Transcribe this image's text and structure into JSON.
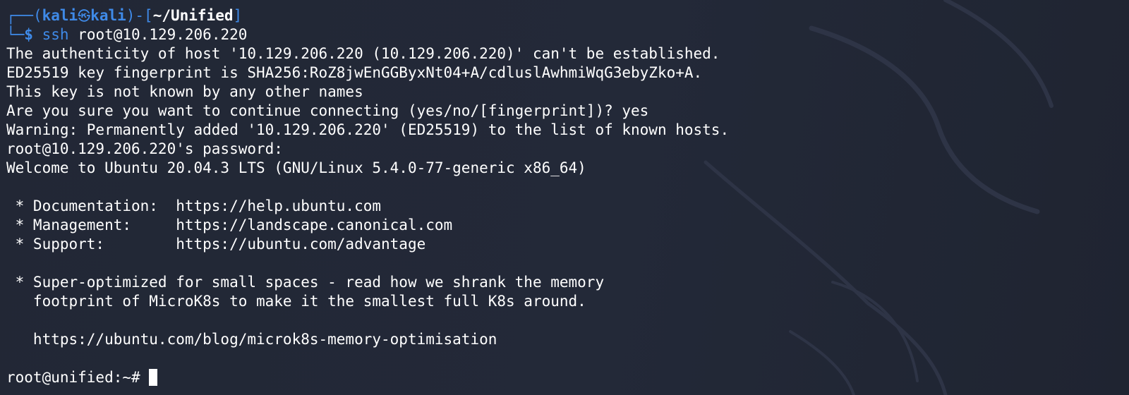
{
  "prompt": {
    "box_top": "┌──",
    "open_paren": "(",
    "user": "kali",
    "skull": "㉿",
    "host": "kali",
    "close_paren_dash": ")-[",
    "cwd": "~/Unified",
    "close_bracket": "]",
    "box_bottom": "└─",
    "dollar": "$ ",
    "command_name": "ssh",
    "command_args": " root@10.129.206.220"
  },
  "output_lines": [
    "The authenticity of host '10.129.206.220 (10.129.206.220)' can't be established.",
    "ED25519 key fingerprint is SHA256:RoZ8jwEnGGByxNt04+A/cdluslAwhmiWqG3ebyZko+A.",
    "This key is not known by any other names",
    "Are you sure you want to continue connecting (yes/no/[fingerprint])? yes",
    "Warning: Permanently added '10.129.206.220' (ED25519) to the list of known hosts.",
    "root@10.129.206.220's password: ",
    "Welcome to Ubuntu 20.04.3 LTS (GNU/Linux 5.4.0-77-generic x86_64)",
    "",
    " * Documentation:  https://help.ubuntu.com",
    " * Management:     https://landscape.canonical.com",
    " * Support:        https://ubuntu.com/advantage",
    "",
    " * Super-optimized for small spaces - read how we shrank the memory",
    "   footprint of MicroK8s to make it the smallest full K8s around.",
    "",
    "   https://ubuntu.com/blog/microk8s-memory-optimisation",
    ""
  ],
  "remote_prompt": "root@unified:~# ",
  "colors": {
    "background": "#232836",
    "text": "#ffffff",
    "accent_blue": "#3f8ae8"
  }
}
